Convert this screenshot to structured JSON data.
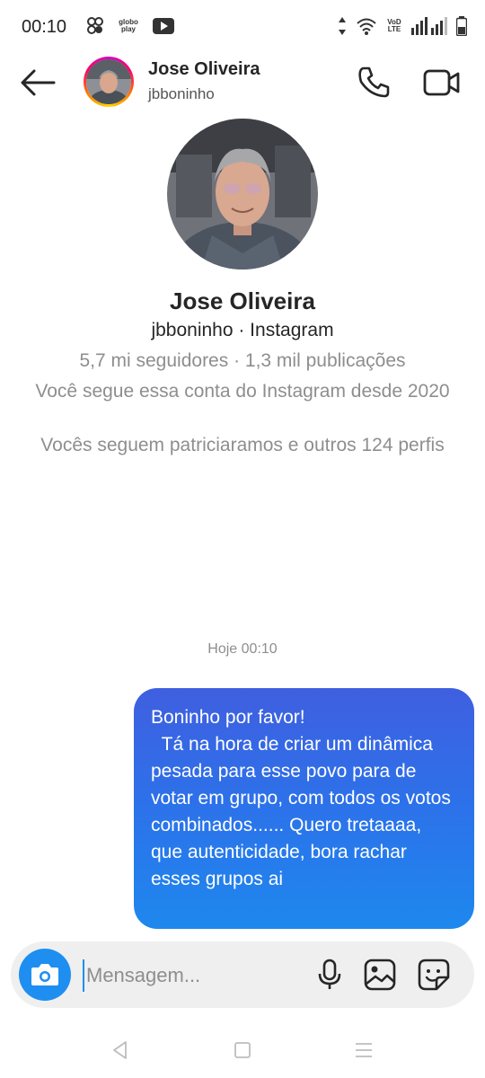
{
  "status_bar": {
    "time": "00:10",
    "globoplay_line1": "globo",
    "globoplay_line2": "play",
    "volte_line1": "VoD",
    "volte_line2": "LTE"
  },
  "header": {
    "name": "Jose Oliveira",
    "username": "jbboninho"
  },
  "profile": {
    "name": "Jose Oliveira",
    "subtitle": "jbboninho · Instagram",
    "stats": "5,7 mi seguidores · 1,3 mil publicações",
    "following_since": "Você segue essa conta do Instagram desde 2020",
    "mutual": "Vocês seguem patriciaramos e outros 124 perfis"
  },
  "conversation": {
    "timestamp": "Hoje 00:10",
    "messages": [
      {
        "sender": "me",
        "text": "Boninho por favor!\n  Tá na hora de criar um dinâmica pesada para esse povo para de votar em grupo, com todos os votos combinados...... Quero tretaaaa, que autenticidade, bora rachar esses grupos ai"
      }
    ]
  },
  "composer": {
    "placeholder": "Mensagem..."
  },
  "icons": {
    "back": "arrow-left-icon",
    "call": "phone-icon",
    "video": "video-camera-icon",
    "camera": "camera-icon",
    "mic": "microphone-icon",
    "gallery": "image-icon",
    "sticker": "sticker-icon"
  },
  "colors": {
    "accent_blue": "#1f8ef1",
    "bubble_top": "#3f5fe0",
    "bubble_bottom": "#1e88ee",
    "muted_text": "#8e8e8e"
  }
}
